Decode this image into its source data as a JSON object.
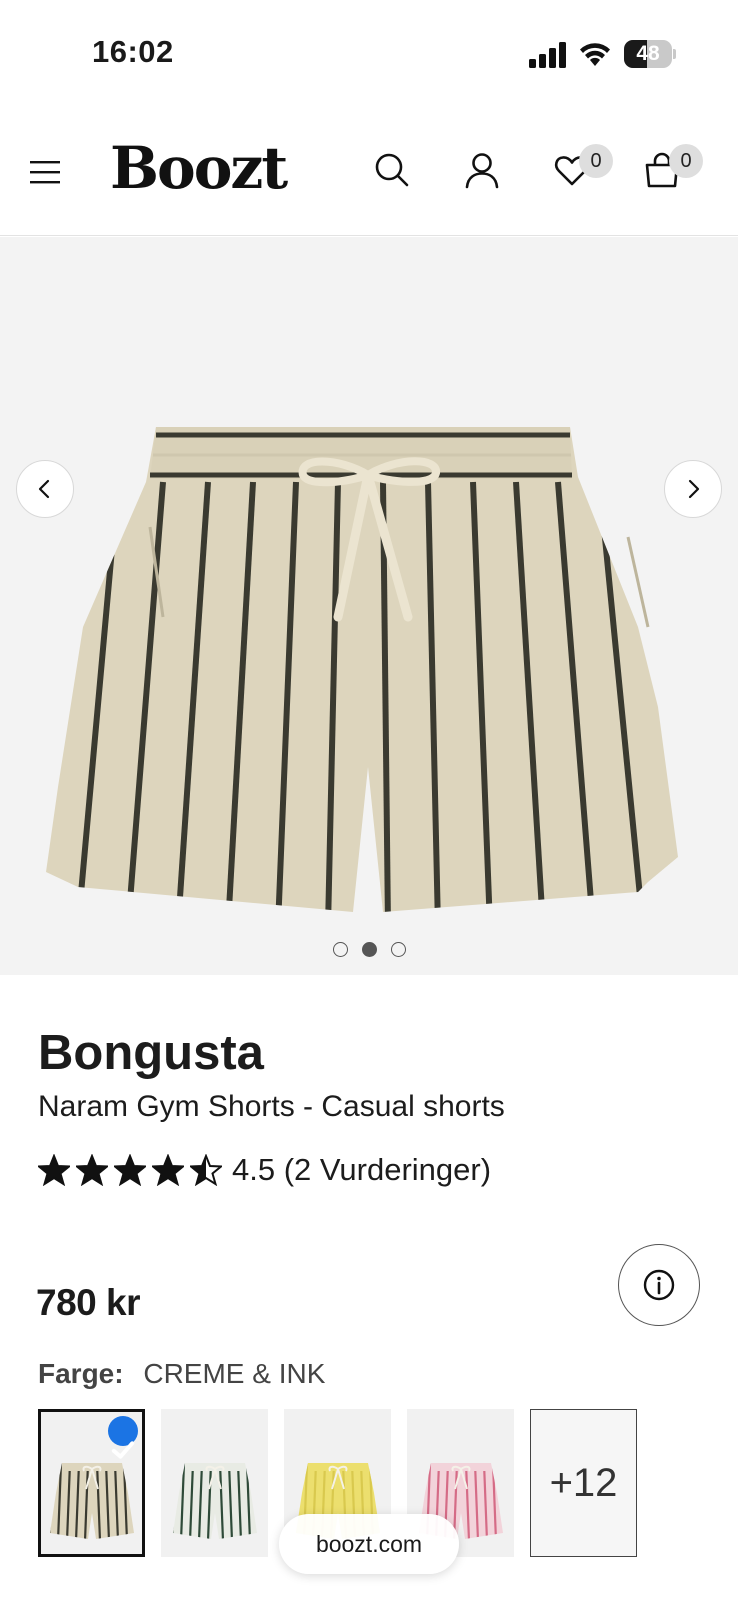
{
  "status_bar": {
    "time": "16:02",
    "battery_level": "48",
    "battery_fraction": 0.48
  },
  "header": {
    "logo": "Boozt",
    "wishlist_count": "0",
    "cart_count": "0"
  },
  "gallery": {
    "image_count": 3,
    "active_index": 1,
    "image_alt_icon": "striped-shorts-image"
  },
  "product": {
    "brand": "Bongusta",
    "name": "Naram Gym Shorts - Casual shorts",
    "rating_value": 4.5,
    "rating_text": "4.5 (2 Vurderinger)",
    "price": "780 kr",
    "color_label": "Farge:",
    "color_value": "CREME & INK"
  },
  "swatches": [
    {
      "name": "creme-ink",
      "base": "#ddd5bd",
      "stripe": "#3a3a30",
      "selected": true
    },
    {
      "name": "green",
      "base": "#e8ebe4",
      "stripe": "#2e4a38",
      "selected": false
    },
    {
      "name": "yellow",
      "base": "#ecdf6e",
      "stripe": "#d9c94e",
      "selected": false
    },
    {
      "name": "pink",
      "base": "#f2d3da",
      "stripe": "#d56b86",
      "selected": false
    }
  ],
  "more_swatches": "+12",
  "browser": {
    "url": "boozt.com"
  },
  "colors": {
    "check_blue": "#1b74e4",
    "gallery_bg": "#f3f3f3"
  }
}
